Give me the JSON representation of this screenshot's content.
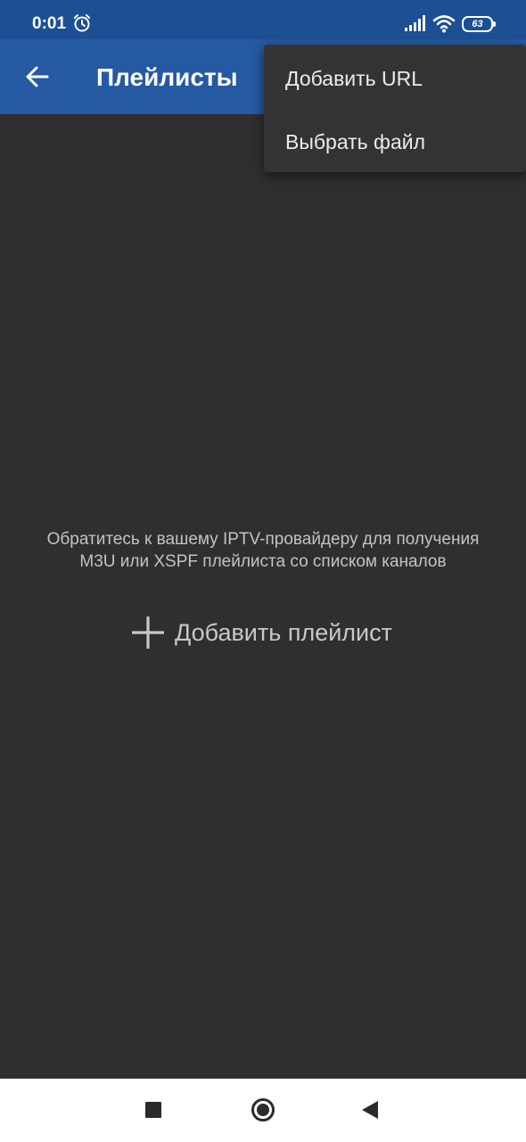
{
  "status_bar": {
    "time": "0:01",
    "battery_level": "63",
    "icons": [
      "alarm-icon",
      "signal-icon",
      "wifi-icon",
      "battery-icon"
    ]
  },
  "app_bar": {
    "title": "Плейлисты",
    "back_icon": "arrow-left-icon",
    "background_color": "#255aa2"
  },
  "overflow_menu": {
    "items": [
      {
        "label": "Добавить URL"
      },
      {
        "label": "Выбрать файл"
      }
    ]
  },
  "empty_state": {
    "hint_line1": "Обратитесь к вашему IPTV-провайдеру для получения",
    "hint_line2": "M3U или XSPF плейлиста со списком каналов",
    "add_button_label": "Добавить плейлист",
    "add_button_icon": "plus-icon"
  },
  "nav_bar": {
    "icons": [
      "recents-square-icon",
      "home-circle-icon",
      "back-triangle-icon"
    ]
  },
  "colors": {
    "status_bar": "#1c4f94",
    "app_bar": "#255aa2",
    "content_background": "#2f2f2f",
    "menu_background": "#333333",
    "nav_bar": "#ffffff"
  }
}
